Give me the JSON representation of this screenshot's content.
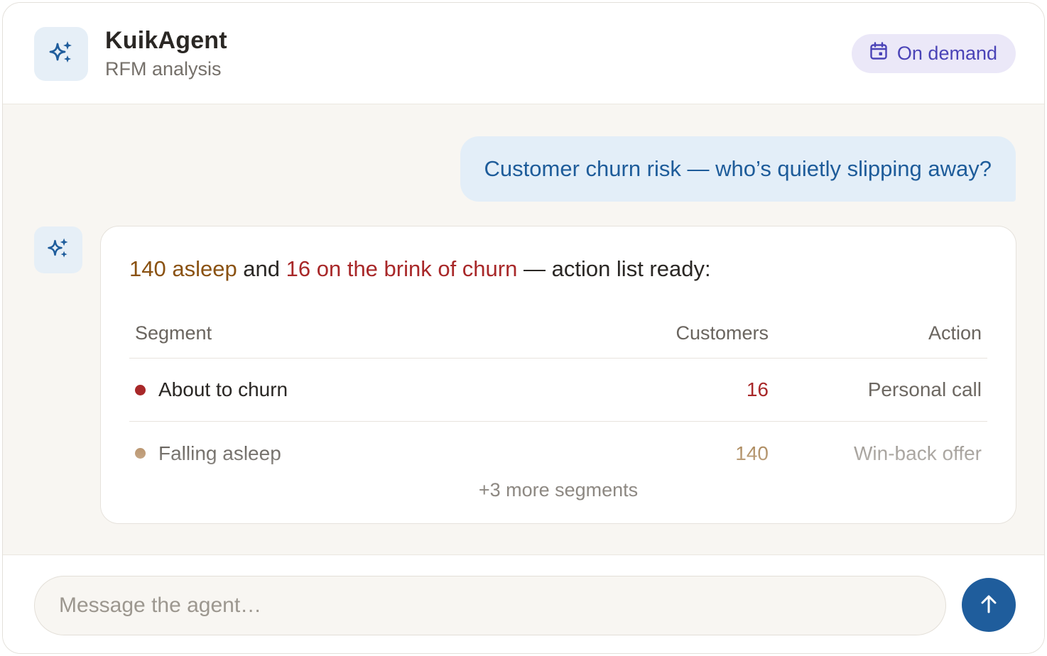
{
  "header": {
    "title": "KuikAgent",
    "subtitle": "RFM analysis",
    "logo_icon": "sparkles-icon",
    "schedule": {
      "icon": "calendar-icon",
      "label": "On demand"
    }
  },
  "conversation": {
    "user_message": "Customer churn risk — who’s quietly slipping away?",
    "agent": {
      "avatar_icon": "sparkles-icon",
      "summary": {
        "part1": "140 asleep",
        "part2": " and ",
        "part3": "16 on the brink of churn",
        "part4": " — action list ready:"
      },
      "table": {
        "columns": [
          "Segment",
          "Customers",
          "Action"
        ],
        "rows": [
          {
            "segment": "About to churn",
            "customers": "16",
            "action": "Personal call",
            "dot_color": "#a82829"
          },
          {
            "segment": "Falling asleep",
            "customers": "140",
            "action": "Win-back offer",
            "dot_color": "#b48c62"
          }
        ],
        "more_label": "+3 more segments"
      }
    }
  },
  "composer": {
    "placeholder": "Message the agent…",
    "value": "",
    "send_icon": "arrow-up-icon"
  },
  "colors": {
    "accent_blue": "#1f5d9c",
    "churn_red": "#a82829",
    "asleep_brown": "#8a5212",
    "schedule_purple": "#4a43b7"
  }
}
